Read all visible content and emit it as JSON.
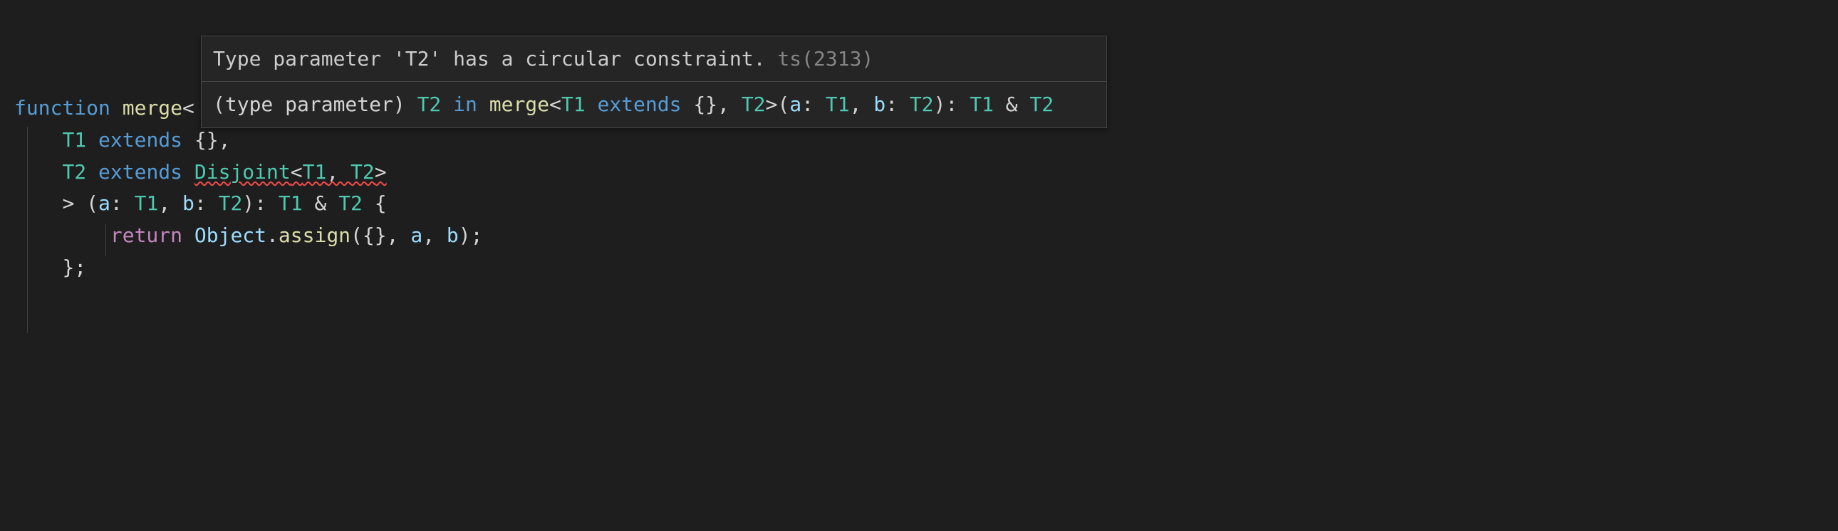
{
  "hover": {
    "error_message": "Type parameter 'T2' has a circular constraint.",
    "error_code": "ts(2313)",
    "sig_prefix": "(type parameter) ",
    "sig_t2": "T2",
    "sig_in": " in ",
    "sig_merge": "merge",
    "sig_lt": "<",
    "sig_t1": "T1",
    "sig_extends": " extends ",
    "sig_empty": "{}",
    "sig_comma": ", ",
    "sig_gt": ">",
    "sig_lparen": "(",
    "sig_a": "a",
    "sig_colon": ": ",
    "sig_b": "b",
    "sig_rparen": ")",
    "sig_amp": " & "
  },
  "code": {
    "l1_function": "function ",
    "l1_merge": "merge",
    "l1_lt": "<",
    "l2_indent": "    ",
    "l2_t1": "T1",
    "l2_extends": " extends ",
    "l2_empty": "{}",
    "l2_comma": ",",
    "l3_indent": "    ",
    "l3_t2": "T2",
    "l3_extends": " extends ",
    "l3_disjoint": "Disjoint",
    "l3_lt": "<",
    "l3_t1": "T1",
    "l3_comma": ", ",
    "l3_t2b": "T2",
    "l3_gt": ">",
    "l4_indent": "    ",
    "l4_gt": "> ",
    "l4_lparen": "(",
    "l4_a": "a",
    "l4_colon": ": ",
    "l4_t1": "T1",
    "l4_comma": ", ",
    "l4_b": "b",
    "l4_t2": "T2",
    "l4_rparen": ")",
    "l4_ret_colon": ": ",
    "l4_amp": " & ",
    "l4_lbrace": " {",
    "l5_indent": "        ",
    "l5_return": "return ",
    "l5_object": "Object",
    "l5_dot": ".",
    "l5_assign": "assign",
    "l5_lparen": "(",
    "l5_empty": "{}",
    "l5_comma": ", ",
    "l5_a": "a",
    "l5_b": "b",
    "l5_rparen": ")",
    "l5_semi": ";",
    "l6_indent": "    ",
    "l6_rbrace": "};"
  }
}
